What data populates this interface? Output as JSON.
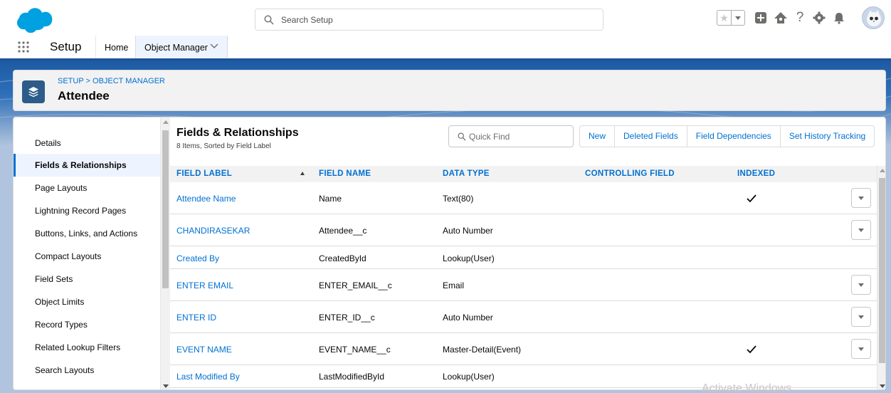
{
  "header": {
    "search_placeholder": "Search Setup",
    "icons": [
      "salesforce-cloud-logo",
      "star-icon",
      "favorites-dropdown-icon",
      "add-icon",
      "trailhead-icon",
      "help-icon",
      "gear-icon",
      "bell-icon",
      "avatar"
    ]
  },
  "app_nav": {
    "app_name": "Setup",
    "tabs": [
      {
        "label": "Home"
      },
      {
        "label": "Object Manager"
      }
    ]
  },
  "object_header": {
    "breadcrumb": "SETUP > OBJECT MANAGER",
    "title": "Attendee"
  },
  "sidebar": {
    "items": [
      {
        "label": "Details"
      },
      {
        "label": "Fields & Relationships",
        "active": true
      },
      {
        "label": "Page Layouts"
      },
      {
        "label": "Lightning Record Pages"
      },
      {
        "label": "Buttons, Links, and Actions"
      },
      {
        "label": "Compact Layouts"
      },
      {
        "label": "Field Sets"
      },
      {
        "label": "Object Limits"
      },
      {
        "label": "Record Types"
      },
      {
        "label": "Related Lookup Filters"
      },
      {
        "label": "Search Layouts"
      }
    ]
  },
  "section": {
    "title": "Fields & Relationships",
    "subtitle": "8 Items, Sorted by Field Label",
    "quick_find_placeholder": "Quick Find",
    "buttons": [
      "New",
      "Deleted Fields",
      "Field Dependencies",
      "Set History Tracking"
    ]
  },
  "table": {
    "columns": [
      "FIELD LABEL",
      "FIELD NAME",
      "DATA TYPE",
      "CONTROLLING FIELD",
      "INDEXED"
    ],
    "rows": [
      {
        "label": "Attendee Name",
        "name": "Name",
        "type": "Text(80)",
        "controlling": "",
        "indexed": true,
        "action": true
      },
      {
        "label": "CHANDIRASEKAR",
        "name": "Attendee__c",
        "type": "Auto Number",
        "controlling": "",
        "indexed": false,
        "action": true
      },
      {
        "label": "Created By",
        "name": "CreatedById",
        "type": "Lookup(User)",
        "controlling": "",
        "indexed": false,
        "action": false
      },
      {
        "label": "ENTER EMAIL",
        "name": "ENTER_EMAIL__c",
        "type": "Email",
        "controlling": "",
        "indexed": false,
        "action": true
      },
      {
        "label": "ENTER ID",
        "name": "ENTER_ID__c",
        "type": "Auto Number",
        "controlling": "",
        "indexed": false,
        "action": true
      },
      {
        "label": "EVENT NAME",
        "name": "EVENT_NAME__c",
        "type": "Master-Detail(Event)",
        "controlling": "",
        "indexed": true,
        "action": true
      },
      {
        "label": "Last Modified By",
        "name": "LastModifiedById",
        "type": "Lookup(User)",
        "controlling": "",
        "indexed": false,
        "action": false
      }
    ]
  },
  "watermark": "Activate Windows",
  "colors": {
    "accent": "#0070d2",
    "nav_bar": "#1b5297",
    "brand_blue": "#00a1e0"
  }
}
